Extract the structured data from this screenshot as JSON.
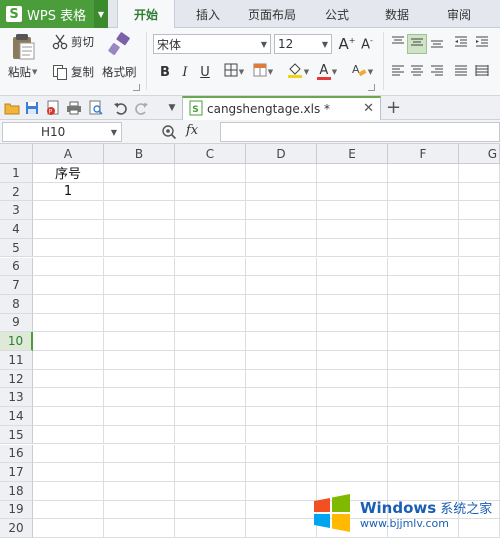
{
  "app": {
    "title": "WPS 表格",
    "logo_letter": "S"
  },
  "menu": {
    "tabs": [
      "开始",
      "插入",
      "页面布局",
      "公式",
      "数据",
      "审阅"
    ],
    "active_tab": "开始"
  },
  "ribbon": {
    "paste_label": "粘贴",
    "cut_label": "剪切",
    "copy_label": "复制",
    "format_painter_label": "格式刷",
    "font_name": "宋体",
    "font_size": "12",
    "bold": "B",
    "italic": "I",
    "underline": "U",
    "font_color_letter": "A"
  },
  "document": {
    "tab_name": "cangshengtage.xls *"
  },
  "formula_bar": {
    "name_box": "H10",
    "fx": "fx",
    "formula": ""
  },
  "sheet": {
    "columns": [
      "A",
      "B",
      "C",
      "D",
      "E",
      "F",
      "G"
    ],
    "rows": [
      "1",
      "2",
      "3",
      "4",
      "5",
      "6",
      "7",
      "8",
      "9",
      "10",
      "11",
      "12",
      "13",
      "14",
      "15",
      "16",
      "17",
      "18",
      "19",
      "20"
    ],
    "active_row": "10",
    "cells": {
      "A1": "序号",
      "A2": "1"
    }
  },
  "watermark": {
    "brand": "Windows",
    "brand_cn": "系统之家",
    "url": "www.bjjmlv.com",
    "colors": [
      "#f25022",
      "#7fba00",
      "#00a4ef",
      "#ffb900"
    ]
  },
  "colors": {
    "accent": "#4a9d3a",
    "active_tab_text": "#2e7d32"
  }
}
